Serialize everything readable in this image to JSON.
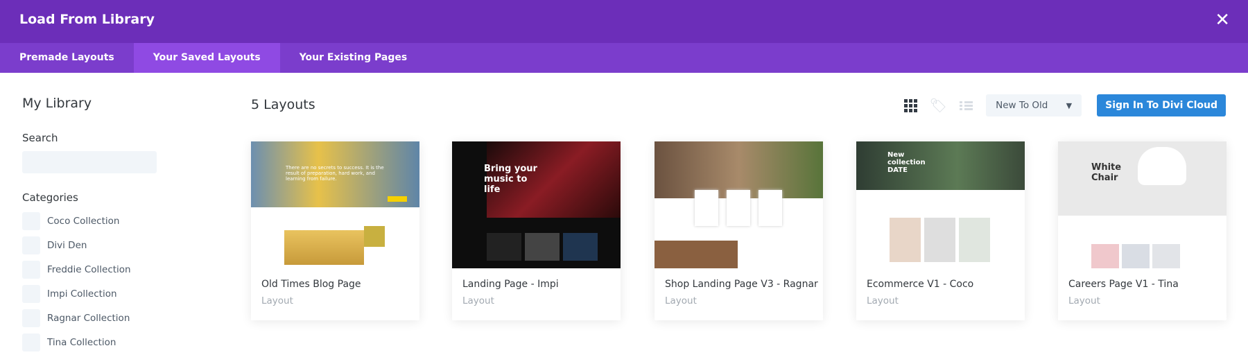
{
  "header": {
    "title": "Load From Library",
    "close_icon": "close-icon"
  },
  "tabs": [
    {
      "label": "Premade Layouts"
    },
    {
      "label": "Your Saved Layouts",
      "active": true
    },
    {
      "label": "Your Existing Pages"
    }
  ],
  "sidebar": {
    "title": "My Library",
    "search_label": "Search",
    "search_value": "",
    "categories_label": "Categories",
    "categories": [
      "Coco Collection",
      "Divi Den",
      "Freddie Collection",
      "Impi Collection",
      "Ragnar Collection",
      "Tina Collection"
    ]
  },
  "main": {
    "count_label": "5 Layouts",
    "sort": "New To Old",
    "sign_in": "Sign In To Divi Cloud",
    "layouts": [
      {
        "title": "Old Times Blog Page",
        "type": "Layout",
        "thumb_text": "There are no secrets to success. It is the result of preparation, hard work, and learning from failure."
      },
      {
        "title": "Landing Page - Impi",
        "type": "Layout",
        "thumb_text": "Bring your music to life"
      },
      {
        "title": "Shop Landing Page V3 - Ragnar",
        "type": "Layout",
        "thumb_text": ""
      },
      {
        "title": "Ecommerce V1 - Coco",
        "type": "Layout",
        "thumb_text": "New collection DATE"
      },
      {
        "title": "Careers Page V1 - Tina",
        "type": "Layout",
        "thumb_text": "White Chair"
      }
    ]
  },
  "colors": {
    "header": "#6c2eb9",
    "tabs": "#7b3dcc",
    "active_tab": "#8f4ae3",
    "button": "#2b87da"
  }
}
